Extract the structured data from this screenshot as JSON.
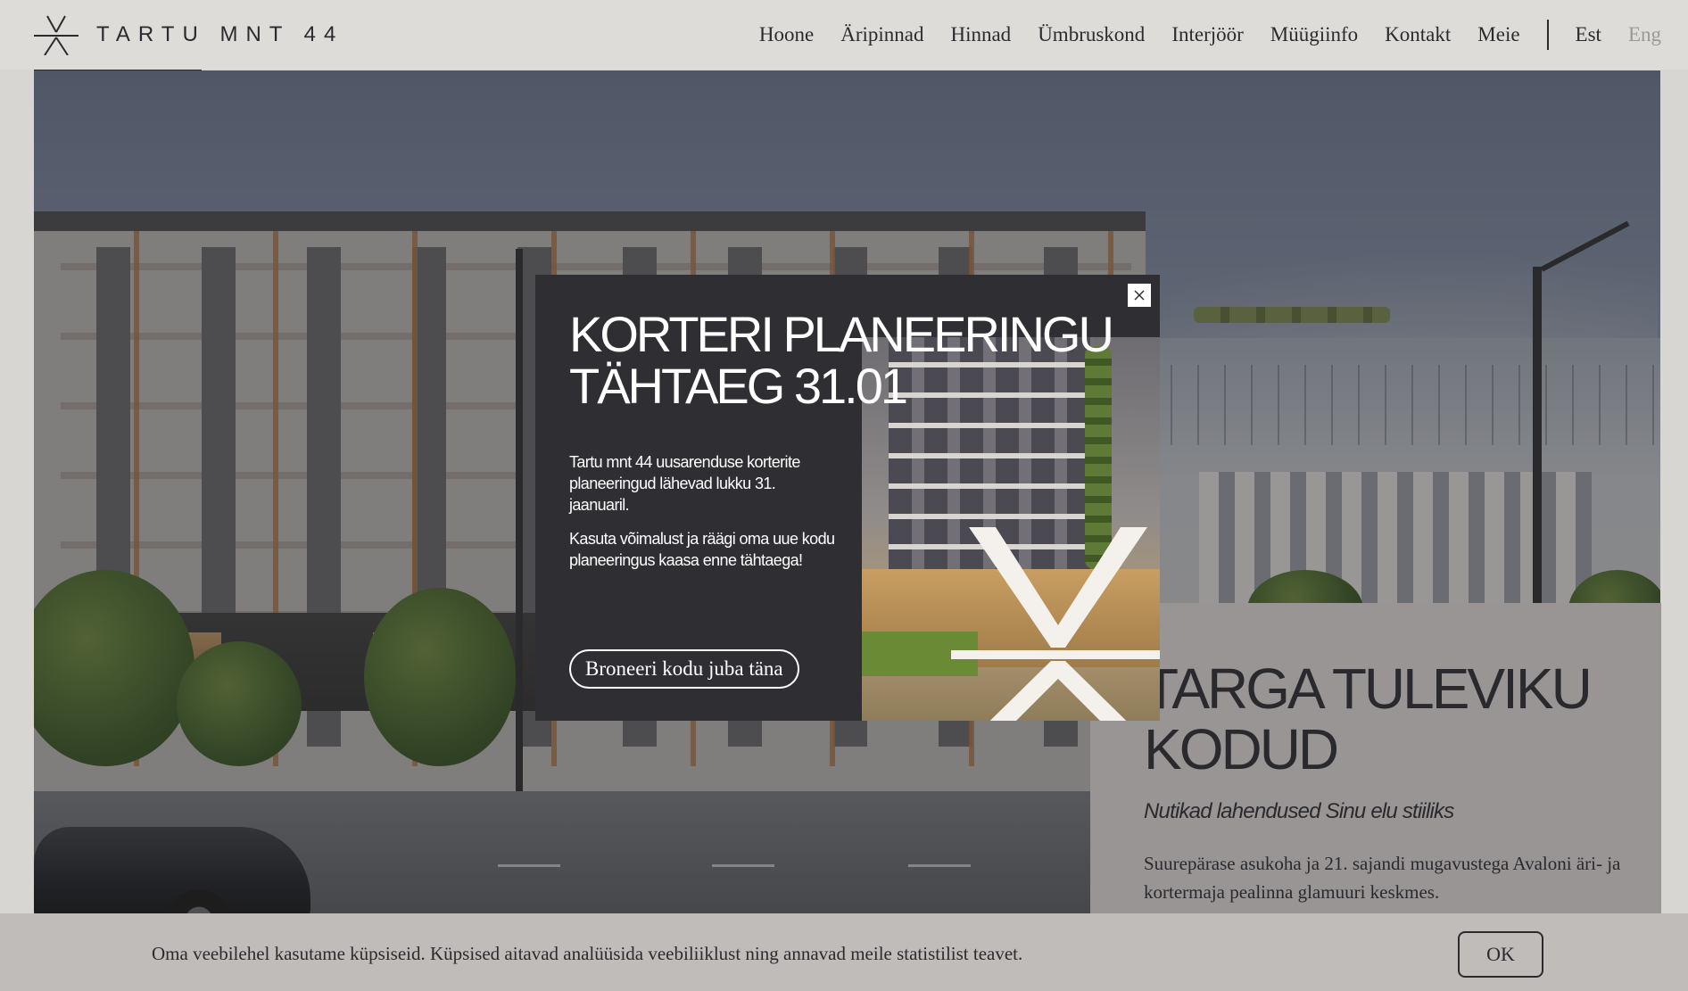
{
  "header": {
    "logo_text": "TARTU MNT 44",
    "nav": [
      "Hoone",
      "Äripinnad",
      "Hinnad",
      "Ümbruskond",
      "Interjöör",
      "Müügiinfo",
      "Kontakt",
      "Meie"
    ],
    "languages": {
      "est": "Est",
      "eng": "Eng"
    }
  },
  "hero": {
    "title": "TARGA TULEVIKU KODUD",
    "subtitle": "Nutikad lahendused Sinu elu stiiliks",
    "body": "Suurepärase asukoha ja 21. sajandi mugavustega Avaloni äri- ja kortermaja pealinna glamuuri keskmes."
  },
  "modal": {
    "title": "KORTERI PLANEERINGU TÄHTAEG 31.01",
    "paragraph1": "Tartu mnt 44 uusarenduse korterite planeeringud lähevad lukku 31. jaanuaril.",
    "paragraph2": "Kasuta võimalust ja räägi oma uue kodu planeeringus kaasa enne tähtaega!",
    "cta": "Broneeri kodu juba täna",
    "close_icon": "close-icon"
  },
  "cookie": {
    "text": "Oma veebilehel kasutame küpsiseid. Küpsised aitavad analüüsida veebiliiklust ning annavad meile statistilist teavet.",
    "ok": "OK"
  },
  "colors": {
    "text_dark": "#2b2a2e",
    "modal_bg": "#2f2e33",
    "panel_bg": "#c9c5c2",
    "inactive_lang": "#9b9996"
  }
}
